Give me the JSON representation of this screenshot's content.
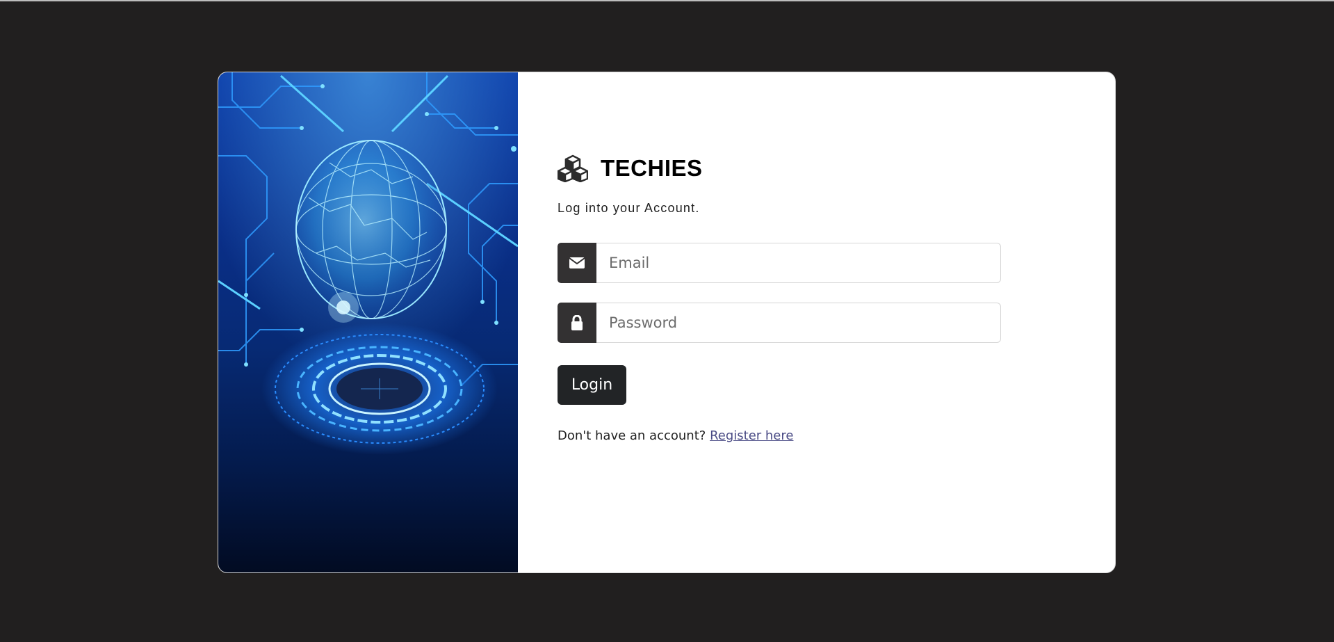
{
  "brand": {
    "icon": "cubes-icon",
    "name": "TECHIES"
  },
  "form": {
    "subtitle": "Log into your Account.",
    "email": {
      "icon": "envelope-icon",
      "placeholder": "Email",
      "value": ""
    },
    "password": {
      "icon": "lock-icon",
      "placeholder": "Password",
      "value": ""
    },
    "submit_label": "Login"
  },
  "register": {
    "prompt": "Don't have an account?",
    "link_label": "Register here"
  },
  "hero": {
    "image": "circuit-globe-illustration"
  },
  "colors": {
    "page_background": "#211f1f",
    "card_background": "#ffffff",
    "addon_background": "#333132",
    "button_background": "#222426",
    "link": "#4b4c86"
  }
}
